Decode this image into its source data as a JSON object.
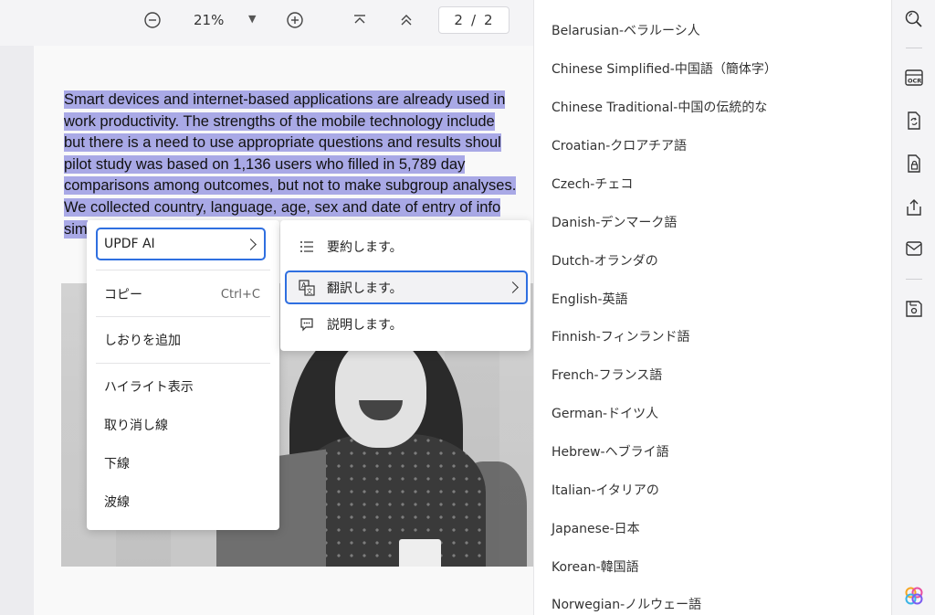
{
  "toolbar": {
    "zoom_out_icon": "minus-circle-icon",
    "zoom_value": "21%",
    "zoom_in_icon": "plus-circle-icon",
    "first_page_icon": "chevron-up-bar-icon",
    "prev_page_icon": "double-chevron-up-icon",
    "current_page": "2",
    "separator": "/",
    "total_pages": "2"
  },
  "document": {
    "lines": [
      "Smart devices and internet-based applications are already used in",
      "work productivity. The strengths of the mobile technology include",
      "but there is a need to use appropriate questions and results shoul",
      "pilot study was based on 1,136 users who filled in 5,789 day",
      "comparisons among outcomes, but not to make subgroup analyses.",
      "We collected country, language, age, sex and date of entry of info",
      "sim"
    ],
    "highlight_color": "#a9a9e6"
  },
  "context_menu": {
    "items": [
      {
        "label": "UPDF AI",
        "shortcut": ""
      },
      {
        "label": "コピー",
        "shortcut": "Ctrl+C"
      },
      {
        "label": "しおりを追加",
        "shortcut": ""
      },
      {
        "label": "ハイライト表示",
        "shortcut": ""
      },
      {
        "label": "取り消し線",
        "shortcut": ""
      },
      {
        "label": "下線",
        "shortcut": ""
      },
      {
        "label": "波線",
        "shortcut": ""
      }
    ]
  },
  "ai_submenu": {
    "items": [
      {
        "label": "要約します。",
        "icon": "list-icon"
      },
      {
        "label": "翻訳します。",
        "icon": "translate-icon"
      },
      {
        "label": "説明します。",
        "icon": "chat-bubble-icon"
      }
    ]
  },
  "languages": [
    "Belarusian-ベラルーシ人",
    "Chinese Simplified-中国語（簡体字）",
    "Chinese Traditional-中国の伝統的な",
    "Croatian-クロアチア語",
    "Czech-チェコ",
    "Danish-デンマーク語",
    "Dutch-オランダの",
    "English-英語",
    "Finnish-フィンランド語",
    "French-フランス語",
    "German-ドイツ人",
    "Hebrew-ヘブライ語",
    "Italian-イタリアの",
    "Japanese-日本",
    "Korean-韓国語",
    "Norwegian-ノルウェー語"
  ],
  "rail": {
    "icons": [
      "search-icon",
      "ocr-icon",
      "convert-icon",
      "protect-icon",
      "share-icon",
      "mail-icon",
      "save-icon",
      "updf-ai-logo-icon"
    ]
  },
  "colors": {
    "accent": "#2f6fe0",
    "selection": "#a9a9e6"
  }
}
